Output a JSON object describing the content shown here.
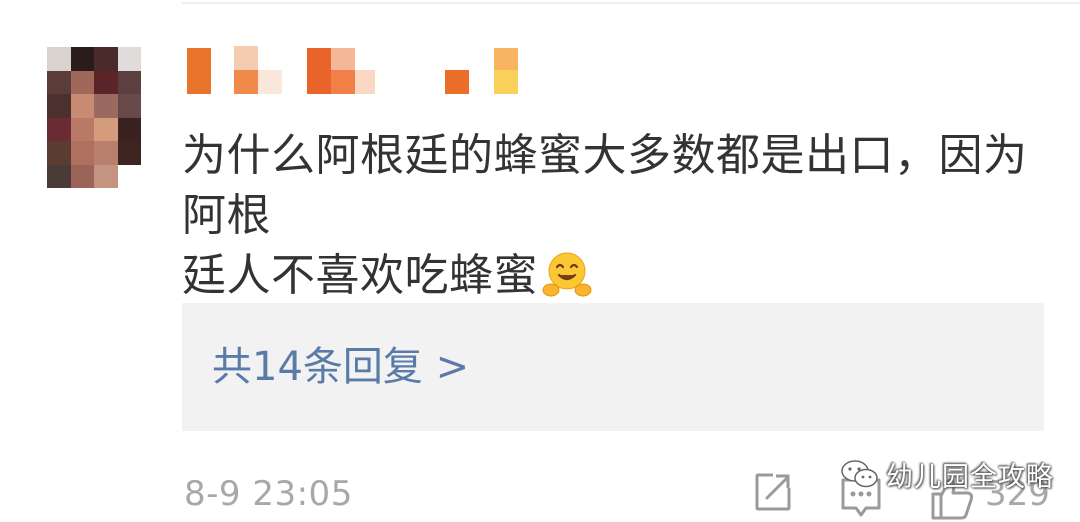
{
  "comment": {
    "text_line1": "为什么阿根廷的蜂蜜大多数都是出口，因为阿根",
    "text_line2": "廷人不喜欢吃蜂蜜",
    "emoji": "hugging-face-emoji"
  },
  "replies": {
    "label": "共14条回复 >"
  },
  "footer": {
    "timestamp": "8-9 23:05",
    "like_count": "329",
    "share_icon": "share-icon",
    "reply_icon": "comment-icon",
    "like_icon": "thumbs-up-icon"
  },
  "watermark": {
    "text": "幼儿园全攻略",
    "icon": "wechat-icon"
  },
  "colors": {
    "link": "#5a7ba8",
    "text": "#333333",
    "muted": "#a8a8a8",
    "reply_bg": "#f2f2f2"
  }
}
